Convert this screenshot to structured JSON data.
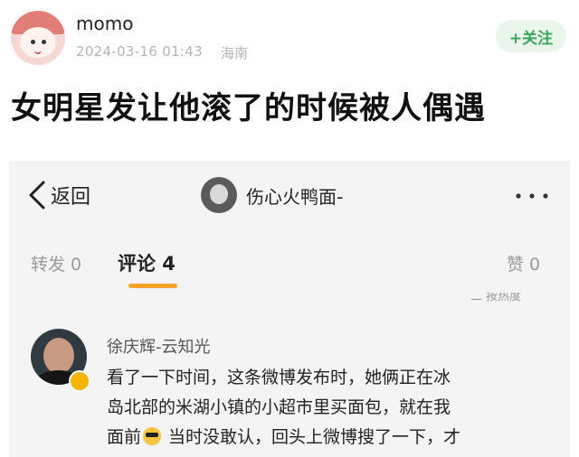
{
  "post": {
    "username": "momo",
    "timestamp": "2024-03-16 01:43",
    "location": "海南",
    "follow_label": "+关注",
    "title": "女明星发让他滚了的时候被人偶遇"
  },
  "embedded": {
    "nav": {
      "back_label": "返回",
      "profile_name": "伤心火鸭面-"
    },
    "tabs": {
      "repost": "转发 0",
      "comments": "评论 4",
      "likes": "赞 0"
    },
    "cut_text": "二 按热度",
    "comment": {
      "author": "徐庆辉-云知光",
      "lines": [
        "看了一下时间，这条微博发布时，她俩正在冰",
        "岛北部的米湖小镇的小超市里买面包，就在我",
        "面前",
        " 当时没敢认，回头上微博搜了一下，才"
      ]
    }
  },
  "colors": {
    "follow_green": "#3aa55a",
    "tab_accent": "#f7a42e",
    "verify_gold": "#f5b400"
  },
  "icons": [
    "back-chevron-icon",
    "more-dots-icon",
    "verify-icon",
    "sunglasses-emoji-icon"
  ]
}
